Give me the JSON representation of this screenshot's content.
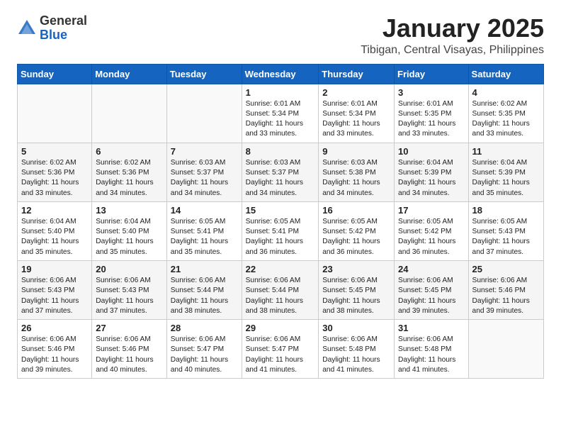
{
  "header": {
    "logo_general": "General",
    "logo_blue": "Blue",
    "title": "January 2025",
    "location": "Tibigan, Central Visayas, Philippines"
  },
  "weekdays": [
    "Sunday",
    "Monday",
    "Tuesday",
    "Wednesday",
    "Thursday",
    "Friday",
    "Saturday"
  ],
  "weeks": [
    [
      {
        "day": "",
        "info": ""
      },
      {
        "day": "",
        "info": ""
      },
      {
        "day": "",
        "info": ""
      },
      {
        "day": "1",
        "info": "Sunrise: 6:01 AM\nSunset: 5:34 PM\nDaylight: 11 hours\nand 33 minutes."
      },
      {
        "day": "2",
        "info": "Sunrise: 6:01 AM\nSunset: 5:34 PM\nDaylight: 11 hours\nand 33 minutes."
      },
      {
        "day": "3",
        "info": "Sunrise: 6:01 AM\nSunset: 5:35 PM\nDaylight: 11 hours\nand 33 minutes."
      },
      {
        "day": "4",
        "info": "Sunrise: 6:02 AM\nSunset: 5:35 PM\nDaylight: 11 hours\nand 33 minutes."
      }
    ],
    [
      {
        "day": "5",
        "info": "Sunrise: 6:02 AM\nSunset: 5:36 PM\nDaylight: 11 hours\nand 33 minutes."
      },
      {
        "day": "6",
        "info": "Sunrise: 6:02 AM\nSunset: 5:36 PM\nDaylight: 11 hours\nand 34 minutes."
      },
      {
        "day": "7",
        "info": "Sunrise: 6:03 AM\nSunset: 5:37 PM\nDaylight: 11 hours\nand 34 minutes."
      },
      {
        "day": "8",
        "info": "Sunrise: 6:03 AM\nSunset: 5:37 PM\nDaylight: 11 hours\nand 34 minutes."
      },
      {
        "day": "9",
        "info": "Sunrise: 6:03 AM\nSunset: 5:38 PM\nDaylight: 11 hours\nand 34 minutes."
      },
      {
        "day": "10",
        "info": "Sunrise: 6:04 AM\nSunset: 5:39 PM\nDaylight: 11 hours\nand 34 minutes."
      },
      {
        "day": "11",
        "info": "Sunrise: 6:04 AM\nSunset: 5:39 PM\nDaylight: 11 hours\nand 35 minutes."
      }
    ],
    [
      {
        "day": "12",
        "info": "Sunrise: 6:04 AM\nSunset: 5:40 PM\nDaylight: 11 hours\nand 35 minutes."
      },
      {
        "day": "13",
        "info": "Sunrise: 6:04 AM\nSunset: 5:40 PM\nDaylight: 11 hours\nand 35 minutes."
      },
      {
        "day": "14",
        "info": "Sunrise: 6:05 AM\nSunset: 5:41 PM\nDaylight: 11 hours\nand 35 minutes."
      },
      {
        "day": "15",
        "info": "Sunrise: 6:05 AM\nSunset: 5:41 PM\nDaylight: 11 hours\nand 36 minutes."
      },
      {
        "day": "16",
        "info": "Sunrise: 6:05 AM\nSunset: 5:42 PM\nDaylight: 11 hours\nand 36 minutes."
      },
      {
        "day": "17",
        "info": "Sunrise: 6:05 AM\nSunset: 5:42 PM\nDaylight: 11 hours\nand 36 minutes."
      },
      {
        "day": "18",
        "info": "Sunrise: 6:05 AM\nSunset: 5:43 PM\nDaylight: 11 hours\nand 37 minutes."
      }
    ],
    [
      {
        "day": "19",
        "info": "Sunrise: 6:06 AM\nSunset: 5:43 PM\nDaylight: 11 hours\nand 37 minutes."
      },
      {
        "day": "20",
        "info": "Sunrise: 6:06 AM\nSunset: 5:43 PM\nDaylight: 11 hours\nand 37 minutes."
      },
      {
        "day": "21",
        "info": "Sunrise: 6:06 AM\nSunset: 5:44 PM\nDaylight: 11 hours\nand 38 minutes."
      },
      {
        "day": "22",
        "info": "Sunrise: 6:06 AM\nSunset: 5:44 PM\nDaylight: 11 hours\nand 38 minutes."
      },
      {
        "day": "23",
        "info": "Sunrise: 6:06 AM\nSunset: 5:45 PM\nDaylight: 11 hours\nand 38 minutes."
      },
      {
        "day": "24",
        "info": "Sunrise: 6:06 AM\nSunset: 5:45 PM\nDaylight: 11 hours\nand 39 minutes."
      },
      {
        "day": "25",
        "info": "Sunrise: 6:06 AM\nSunset: 5:46 PM\nDaylight: 11 hours\nand 39 minutes."
      }
    ],
    [
      {
        "day": "26",
        "info": "Sunrise: 6:06 AM\nSunset: 5:46 PM\nDaylight: 11 hours\nand 39 minutes."
      },
      {
        "day": "27",
        "info": "Sunrise: 6:06 AM\nSunset: 5:46 PM\nDaylight: 11 hours\nand 40 minutes."
      },
      {
        "day": "28",
        "info": "Sunrise: 6:06 AM\nSunset: 5:47 PM\nDaylight: 11 hours\nand 40 minutes."
      },
      {
        "day": "29",
        "info": "Sunrise: 6:06 AM\nSunset: 5:47 PM\nDaylight: 11 hours\nand 41 minutes."
      },
      {
        "day": "30",
        "info": "Sunrise: 6:06 AM\nSunset: 5:48 PM\nDaylight: 11 hours\nand 41 minutes."
      },
      {
        "day": "31",
        "info": "Sunrise: 6:06 AM\nSunset: 5:48 PM\nDaylight: 11 hours\nand 41 minutes."
      },
      {
        "day": "",
        "info": ""
      }
    ]
  ]
}
